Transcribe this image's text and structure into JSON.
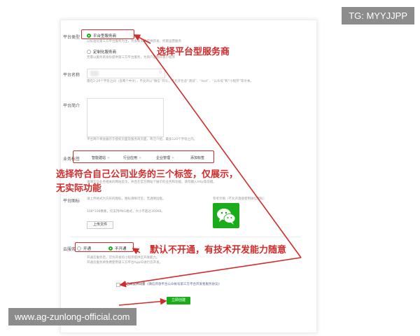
{
  "watermarks": {
    "top": "TG: MYYJJPP",
    "bottom": "www.ag-zunlong-official.com"
  },
  "form": {
    "platform_type": {
      "label": "平台类型",
      "option_platform": "平台型服务商",
      "option_custom": "定制化服务商",
      "desc_platform": "以标准化第三方平台服务为主，为多家商家提供开发、托管运营服务",
      "desc_custom": "无需以服务商身份提供第三方平台服务，为商户定制开发小程序"
    },
    "platform_name": {
      "label": "平台名称",
      "value": "",
      "hint": "需在2-29个字符之间（含两个中文），不允许以“微信”开头，不允许包含“测试”、“test”、“公众号”和“小程序”等文本。"
    },
    "platform_intro": {
      "label": "平台简介",
      "hint": "平台简介将会展示于授权页面及服务商页面，简洁介绍，最多120个字符之内。"
    },
    "business_tags": {
      "label": "业务标签",
      "tags": [
        "智能建站",
        "行业应用",
        "企业管理",
        "添加标签"
      ],
      "hint": "请填写与业务相关的网站首页，并且在官方网站下展示的业务和功能。请勿输入http等前缀。"
    },
    "platform_icon": {
      "label": "平台图标",
      "desc": "请上传格式为方形的图标，图标清晰可见，无透明边框。",
      "spec": "108*108像素，仅支持PNG格式，大小不超过300KB。",
      "upload_label": "上传文件",
      "example_label": "参考示例（不允许直接使用微信图标）"
    },
    "cloud_service": {
      "label": "云服务",
      "option_on": "开通",
      "option_off": "不开通",
      "desc_1": "开通云服务后，可为开发的小程序提供云开发能力。",
      "desc_2": "开通云服务将免费使用第三方平台AppID进行云开发。"
    },
    "agreement": {
      "label": "我已阅读并同意",
      "link": "《微信开放平台公众帐号第三方平台开发者服务协议》"
    },
    "submit_label": "立即创建"
  },
  "annotations": {
    "note_1": "选择平台型服务商",
    "note_2_line1": "选择符合自己公司业务的三个标签，仅展示，",
    "note_2_line2": "无实际功能",
    "note_3": "默认不开通，有技术开发能力随意"
  },
  "colors": {
    "accent_green": "#1aad19",
    "annotation_red": "#d42a2a",
    "watermark_bg": "#8c8c8c"
  }
}
